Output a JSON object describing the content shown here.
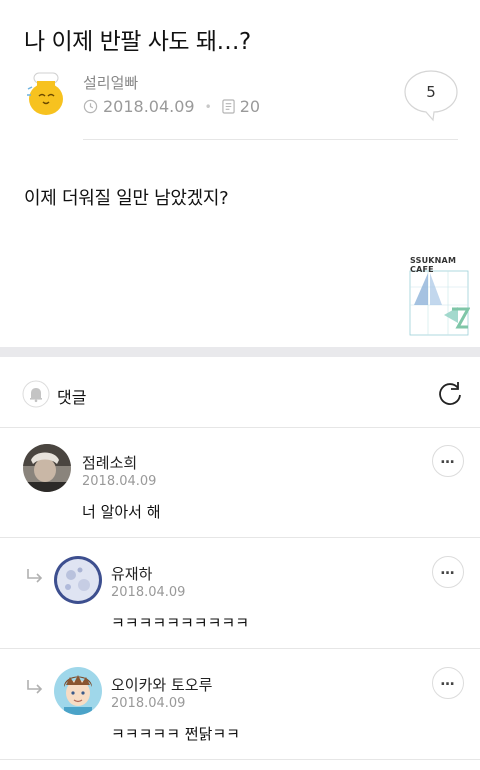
{
  "post": {
    "title": "나 이제 반팔 사도 돼…?",
    "author": "설리얼빠",
    "date": "2018.04.09",
    "views": "20",
    "comment_count": "5",
    "body": "이제 더워질 일만 남았겠지?",
    "watermark": "SSUKNAM CAFE"
  },
  "comments_section": {
    "label": "댓글"
  },
  "comments": [
    {
      "name": "점례소희",
      "date": "2018.04.09",
      "text": "너 알아서 해"
    },
    {
      "name": "유재하",
      "date": "2018.04.09",
      "text": "ㅋㅋㅋㅋㅋㅋㅋㅋㅋㅋ"
    },
    {
      "name": "오이카와 토오루",
      "date": "2018.04.09",
      "text": "ㅋㅋㅋㅋㅋ 쩐닭ㅋㅋ"
    }
  ],
  "icons": {
    "clock": "clock-icon",
    "views": "document-icon",
    "comment": "comment-bubble-icon",
    "bell": "bell-icon",
    "refresh": "refresh-icon",
    "more": "more-icon",
    "reply": "reply-arrow-icon"
  },
  "colors": {
    "meta_gray": "#9a9a9a",
    "band": "#e9e9ec",
    "avatar_honey": "#f7c21f"
  }
}
